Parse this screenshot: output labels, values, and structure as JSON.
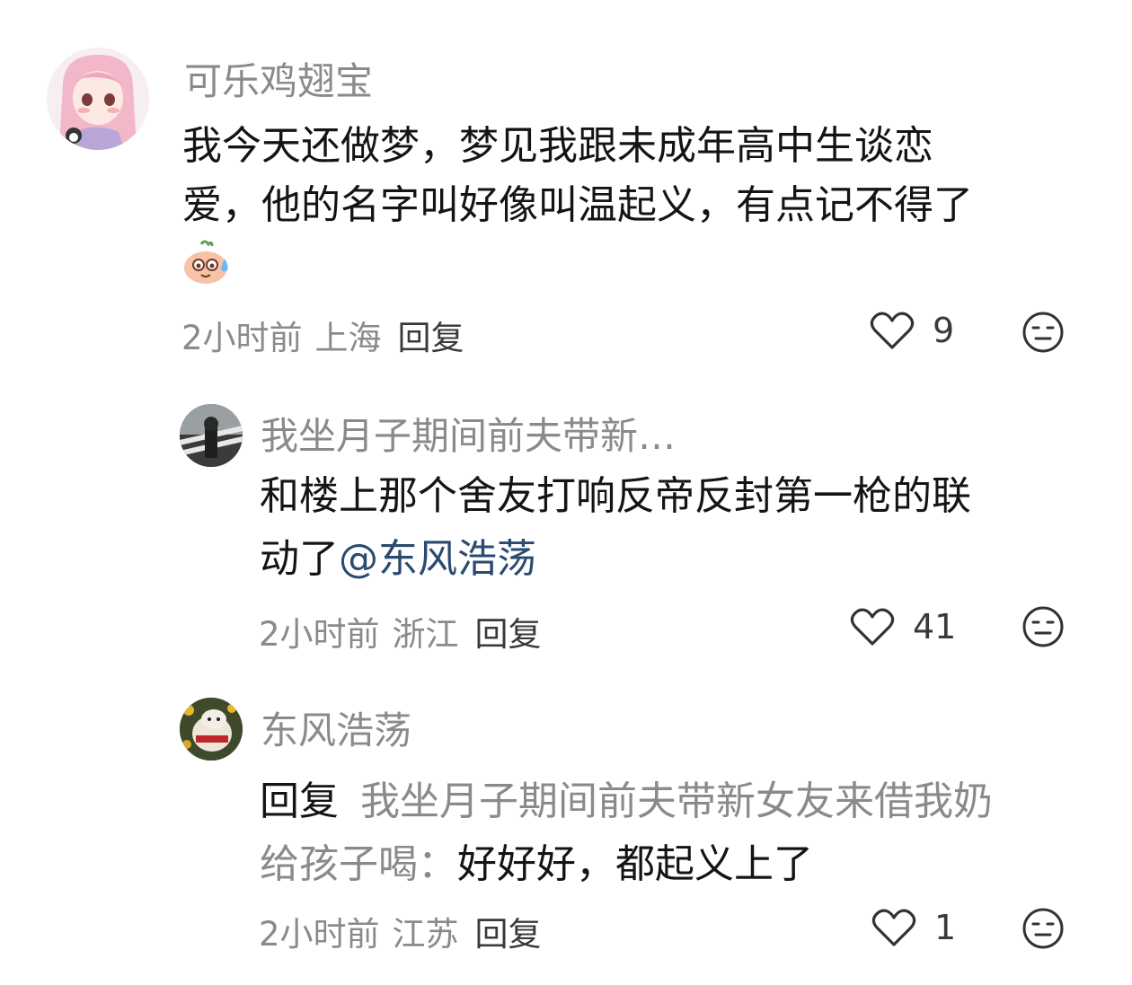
{
  "comments": [
    {
      "username": "可乐鸡翅宝",
      "text_line1": "我今天还做梦，梦见我跟未成年高中生谈恋",
      "text_line2": "爱，他的名字叫好像叫温起义，有点记不得了",
      "emoji_icon": "sweat-face-emoji",
      "time": "2小时前",
      "location": "上海",
      "reply_label": "回复",
      "like_count": "9"
    },
    {
      "username": "我坐月子期间前夫带新…",
      "text_line1": "和楼上那个舍友打响反帝反封第一枪的联",
      "text_line2_prefix": "动了",
      "mention": "@东风浩荡",
      "time": "2小时前",
      "location": "浙江",
      "reply_label": "回复",
      "like_count": "41"
    },
    {
      "username": "东风浩荡",
      "reply_prefix": "回复",
      "reply_target_line1": "我坐月子期间前夫带新女友来借我奶",
      "reply_target_line2": "给孩子喝：",
      "text_line2_rest": "好好好，都起义上了",
      "time": "2小时前",
      "location": "江苏",
      "reply_label": "回复",
      "like_count": "1"
    }
  ],
  "colors": {
    "username": "#8a8a8a",
    "text": "#141414",
    "mention": "#2a4a70",
    "meta": "#8a8a8a"
  }
}
